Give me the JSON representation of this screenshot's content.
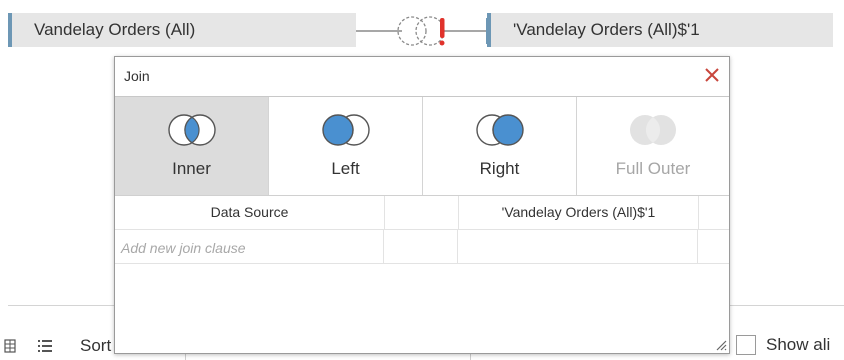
{
  "tables": {
    "left": "Vandelay Orders (All)",
    "right": "'Vandelay Orders (All)$'1"
  },
  "join_link": {
    "icon": "join-warning-icon",
    "warning_color": "#e0322b"
  },
  "dialog": {
    "title": "Join",
    "close_icon": "close-icon",
    "join_types": [
      {
        "label": "Inner",
        "selected": true
      },
      {
        "label": "Left",
        "selected": false
      },
      {
        "label": "Right",
        "selected": false
      },
      {
        "label": "Full Outer",
        "selected": false,
        "disabled": true
      }
    ],
    "clause_headers": {
      "left": "Data Source",
      "right": "'Vandelay Orders (All)$'1"
    },
    "add_clause": "Add new join clause"
  },
  "bottom_bar": {
    "sort_label": "Sort",
    "show_label": "Show ali"
  },
  "colors": {
    "accent_blue": "#4a90d0",
    "pill_bg": "#e6e6e6",
    "pill_border": "#6d97b5"
  }
}
